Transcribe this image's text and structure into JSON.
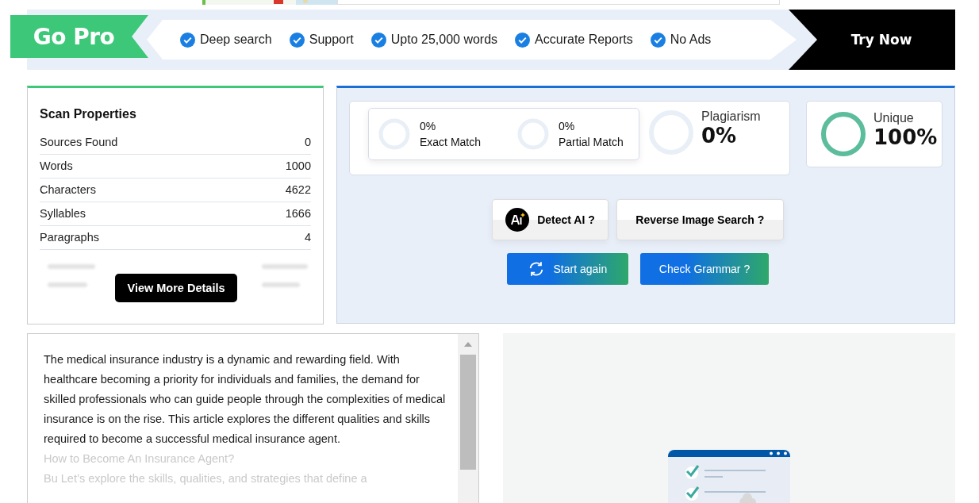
{
  "promo": {
    "badge": "Go Pro",
    "features": [
      "Deep search",
      "Support",
      "Upto 25,000 words",
      "Accurate Reports",
      "No Ads"
    ],
    "button": "Try Now"
  },
  "scan_properties": {
    "title": "Scan Properties",
    "rows": [
      {
        "label": "Sources Found",
        "value": "0"
      },
      {
        "label": "Words",
        "value": "1000"
      },
      {
        "label": "Characters",
        "value": "4622"
      },
      {
        "label": "Syllables",
        "value": "1666"
      },
      {
        "label": "Paragraphs",
        "value": "4"
      }
    ],
    "button": "View More Details"
  },
  "results": {
    "matches": [
      {
        "value": "0%",
        "label": "Exact Match",
        "level": 0
      },
      {
        "value": "0%",
        "label": "Partial Match",
        "level": 0
      }
    ],
    "plagiarism": {
      "label": "Plagiarism",
      "value": "0%",
      "level": 0
    },
    "unique": {
      "label": "Unique",
      "value": "100%",
      "level": 1
    },
    "tools": [
      {
        "kind": "ai",
        "label": "Detect AI ?"
      },
      {
        "kind": "plain",
        "label": "Reverse Image Search ?"
      }
    ],
    "actions": [
      {
        "kind": "refresh",
        "label": "Start again"
      },
      {
        "kind": "plain",
        "label": "Check Grammar ?"
      }
    ]
  },
  "document": {
    "paragraphs": [
      {
        "text": "The medical insurance industry is a dynamic and rewarding field. With healthcare becoming a priority for individuals and families, the demand for skilled professionals who can guide people through the complexities of medical insurance is on the rise. This article explores the different qualities and skills required to become a successful medical insurance agent.",
        "faded": false
      },
      {
        "text": "How to Become An Insurance Agent?",
        "faded": true
      },
      {
        "text": "Bu Let’s explore the skills, qualities, and strategies that define a",
        "faded": true
      }
    ]
  }
}
